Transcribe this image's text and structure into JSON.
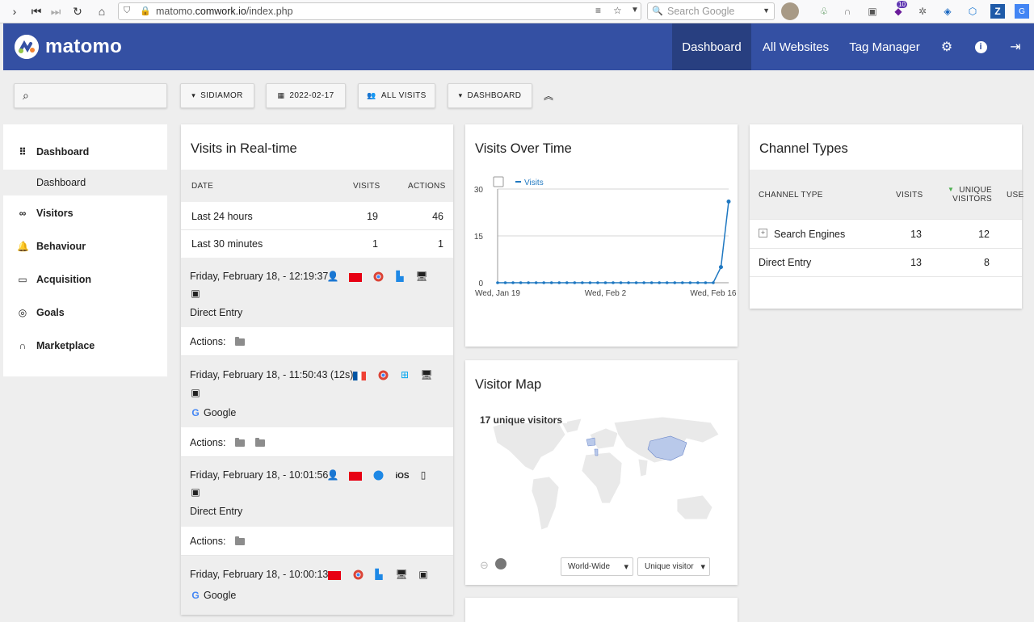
{
  "browser": {
    "url_prefix": "matomo.",
    "url_domain": "comwork.io",
    "url_path": "/index.php",
    "search_placeholder": "Search Google",
    "ext_badge": "10"
  },
  "topbar": {
    "logo": "matomo",
    "nav": [
      "Dashboard",
      "All Websites",
      "Tag Manager"
    ]
  },
  "controls": {
    "site": "SIDIAMOR",
    "date": "2022-02-17",
    "segment": "ALL VISITS",
    "dashboard": "DASHBOARD"
  },
  "sidebar": {
    "items": [
      {
        "label": "Dashboard",
        "icon": "grid-icon"
      },
      {
        "label": "Visitors",
        "icon": "binoculars-icon"
      },
      {
        "label": "Behaviour",
        "icon": "bell-icon"
      },
      {
        "label": "Acquisition",
        "icon": "browser-window-icon"
      },
      {
        "label": "Goals",
        "icon": "target-icon"
      },
      {
        "label": "Marketplace",
        "icon": "headphones-icon"
      }
    ],
    "sub_item": "Dashboard"
  },
  "realtime": {
    "title": "Visits in Real-time",
    "headers": [
      "DATE",
      "VISITS",
      "ACTIONS"
    ],
    "rows": [
      {
        "label": "Last 24 hours",
        "visits": "19",
        "actions": "46"
      },
      {
        "label": "Last 30 minutes",
        "visits": "1",
        "actions": "1"
      }
    ],
    "visits": [
      {
        "time": "Friday, February 18, - 12:19:37",
        "referrer": "Direct Entry",
        "actions_label": "Actions:"
      },
      {
        "time": "Friday, February 18, - 11:50:43 (12s)",
        "referrer": "Google",
        "actions_label": "Actions:"
      },
      {
        "time": "Friday, February 18, - 10:01:56",
        "referrer": "Direct Entry",
        "actions_label": "Actions:",
        "os": "iOS"
      },
      {
        "time": "Friday, February 18, - 10:00:13",
        "referrer": "Google"
      }
    ]
  },
  "visits_over_time": {
    "title": "Visits Over Time",
    "legend": "Visits"
  },
  "chart_data": {
    "type": "line",
    "title": "Visits Over Time",
    "series": [
      {
        "name": "Visits",
        "values": [
          0,
          0,
          0,
          0,
          0,
          0,
          0,
          0,
          0,
          0,
          0,
          0,
          0,
          0,
          0,
          0,
          0,
          0,
          0,
          0,
          0,
          0,
          0,
          0,
          0,
          0,
          0,
          0,
          0,
          5,
          26
        ]
      }
    ],
    "x_tick_labels": [
      "Wed, Jan 19",
      "Wed, Feb 2",
      "Wed, Feb 16"
    ],
    "ylim": [
      0,
      30
    ],
    "y_ticks": [
      0,
      15,
      30
    ],
    "grid": true,
    "color": "#1f78c1"
  },
  "visitor_map": {
    "title": "Visitor Map",
    "summary": "17 unique visitors",
    "region_select": "World-Wide",
    "metric_select": "Unique visitor"
  },
  "channel_types": {
    "title": "Channel Types",
    "headers": [
      "CHANNEL TYPE",
      "VISITS",
      "UNIQUE VISITORS",
      "USE"
    ],
    "rows": [
      {
        "label": "Search Engines",
        "visits": "13",
        "unique": "12"
      },
      {
        "label": "Direct Entry",
        "visits": "13",
        "unique": "8"
      }
    ]
  },
  "colors": {
    "topbar": "#3450a3",
    "active_nav": "#283f80",
    "line": "#1f78c1"
  }
}
